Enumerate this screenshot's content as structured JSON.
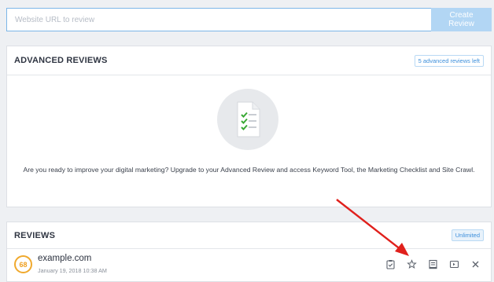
{
  "search": {
    "placeholder": "Website URL to review",
    "button_label": "Create Review"
  },
  "advanced": {
    "title": "ADVANCED REVIEWS",
    "badge": "5 advanced reviews left",
    "icon": "checklist-document-icon",
    "message": "Are you ready to improve your digital marketing? Upgrade to your Advanced Review and access Keyword Tool, the Marketing Checklist and Site Crawl."
  },
  "reviews": {
    "title": "REVIEWS",
    "badge": "Unlimited",
    "items": [
      {
        "score": "68",
        "site": "example.com",
        "date": "January 19, 2018 10:38 AM",
        "actions": [
          "clipboard-check-icon",
          "star-icon",
          "report-icon",
          "export-icon",
          "close-icon"
        ]
      }
    ]
  },
  "colors": {
    "accent": "#3d8fdb",
    "score": "#f0a92d",
    "annotation_arrow": "#e0201c",
    "check": "#3aa935"
  }
}
